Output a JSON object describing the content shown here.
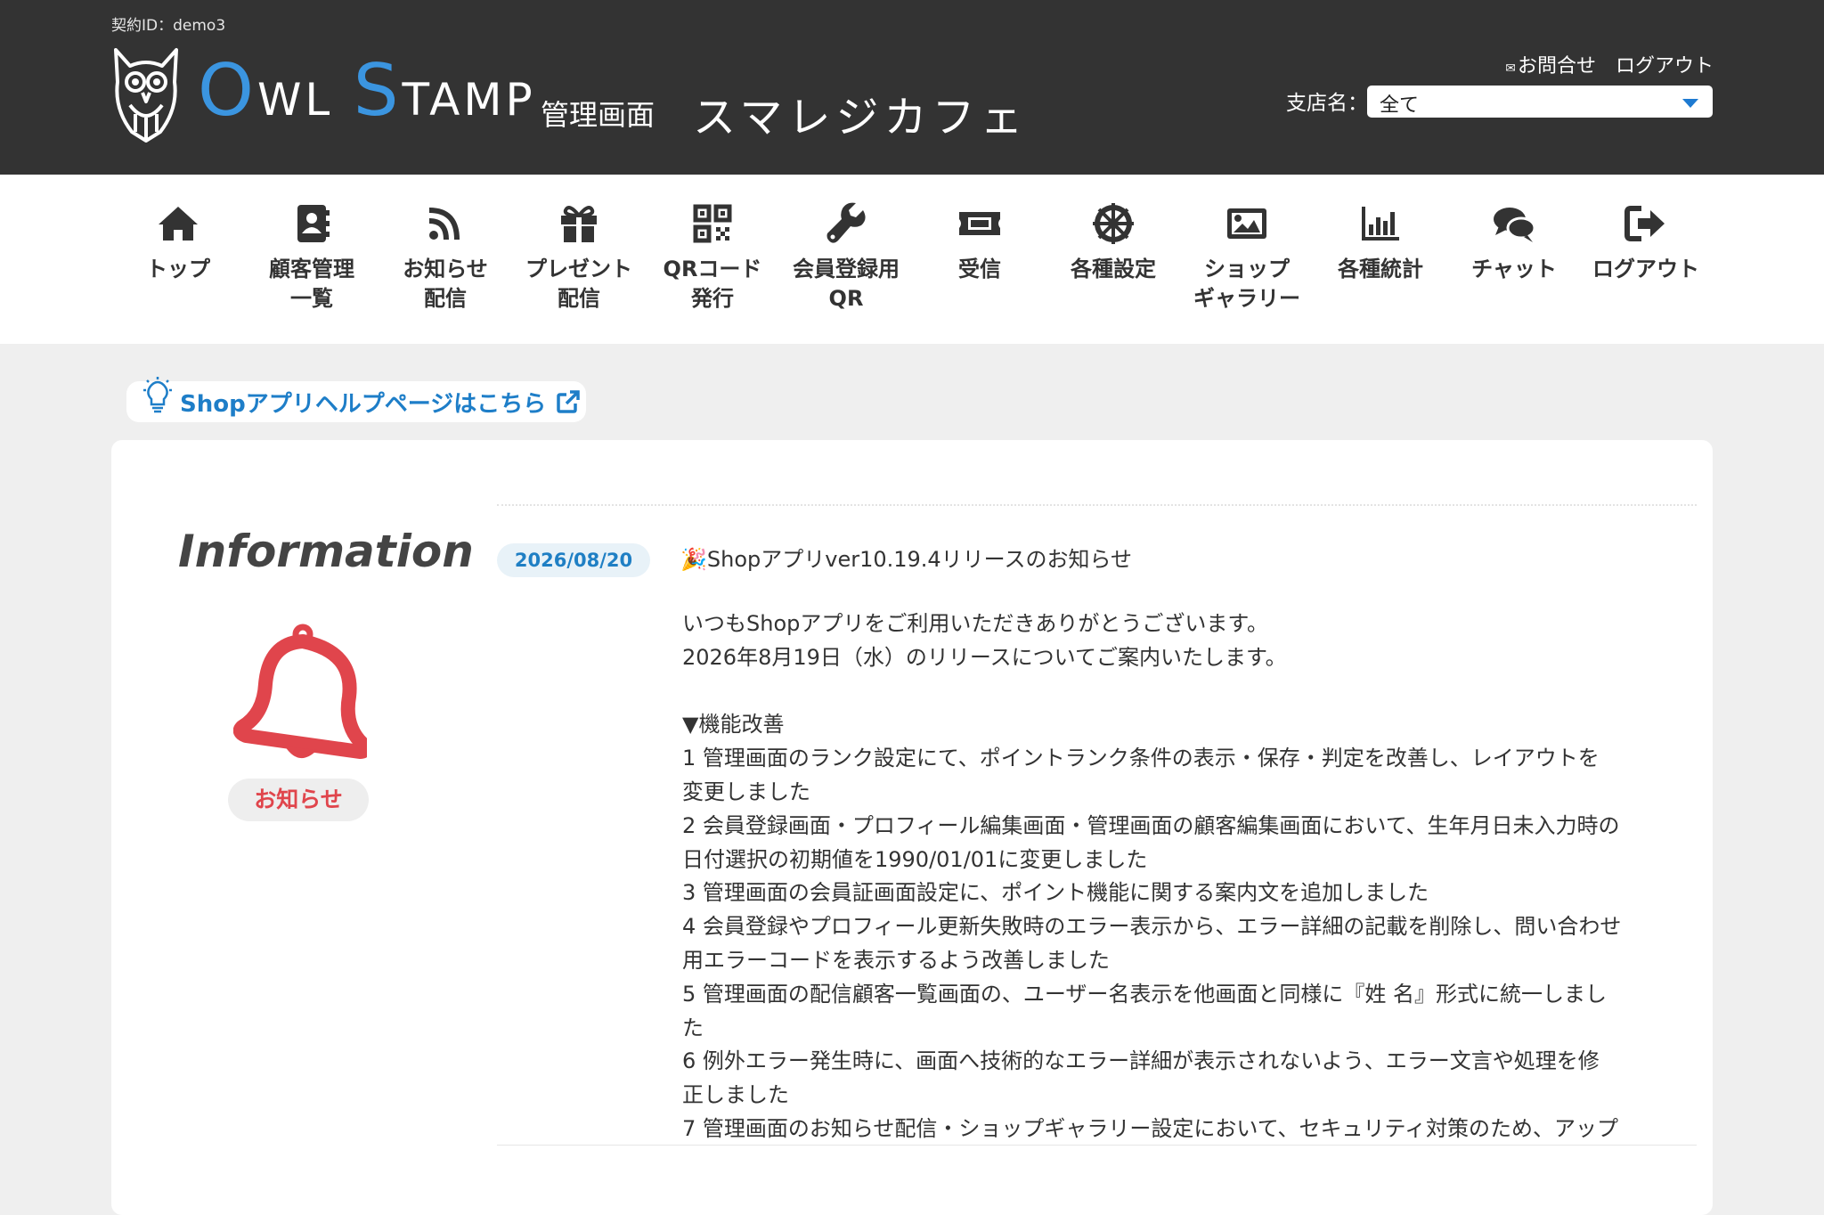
{
  "header": {
    "contract_id": "契約ID：demo3",
    "logo": {
      "o": "O",
      "wl": "WL",
      "s": "S",
      "tamp": "TAMP",
      "sub": "管理画面"
    },
    "shop_name": "スマレジカフェ",
    "contact_label": "お問合せ",
    "logout_label": "ログアウト",
    "branch_label": "支店名：",
    "branch_value": "全て"
  },
  "nav": {
    "items": [
      {
        "label": "トップ",
        "icon": "home-icon"
      },
      {
        "label": "顧客管理\n一覧",
        "icon": "address-book-icon"
      },
      {
        "label": "お知らせ\n配信",
        "icon": "rss-icon"
      },
      {
        "label": "プレゼント\n配信",
        "icon": "gift-icon"
      },
      {
        "label": "QRコード\n発行",
        "icon": "qrcode-icon"
      },
      {
        "label": "会員登録用\nQR",
        "icon": "wrench-icon"
      },
      {
        "label": "受信",
        "icon": "ticket-icon"
      },
      {
        "label": "各種設定",
        "icon": "wheel-icon"
      },
      {
        "label": "ショップ\nギャラリー",
        "icon": "image-icon"
      },
      {
        "label": "各種統計",
        "icon": "bar-chart-icon"
      },
      {
        "label": "チャット",
        "icon": "comments-icon"
      },
      {
        "label": "ログアウト",
        "icon": "sign-out-icon"
      }
    ]
  },
  "help_link": "Shopアプリヘルプページはこちら",
  "info": {
    "title": "Information",
    "badge": "お知らせ",
    "date": "2026/08/20",
    "news_title": "🎉Shopアプリver10.19.4リリースのお知らせ",
    "body": "いつもShopアプリをご利用いただきありがとうございます。\n2026年8月19日（水）のリリースについてご案内いたします。\n\n▼機能改善\n1 管理画面のランク設定にて、ポイントランク条件の表示・保存・判定を改善し、レイアウトを\n変更しました\n2 会員登録画面・プロフィール編集画面・管理画面の顧客編集画面において、生年月日未入力時の\n日付選択の初期値を1990/01/01に変更しました\n3 管理画面の会員証画面設定に、ポイント機能に関する案内文を追加しました\n4 会員登録やプロフィール更新失敗時のエラー表示から、エラー詳細の記載を削除し、問い合わせ\n用エラーコードを表示するよう改善しました\n5 管理画面の配信顧客一覧画面の、ユーザー名表示を他画面と同様に『姓 名』形式に統一しまし\nた\n6 例外エラー発生時に、画面へ技術的なエラー詳細が表示されないよう、エラー文言や処理を修\n正しました\n7 管理画面のお知らせ配信・ショップギャラリー設定において、セキュリティ対策のため、アップ"
  },
  "colors": {
    "header_bg": "#333333",
    "accent_blue": "#3b95e0",
    "link_blue": "#1e7ec8",
    "bell_red": "#e0454c",
    "page_bg": "#efefef"
  }
}
